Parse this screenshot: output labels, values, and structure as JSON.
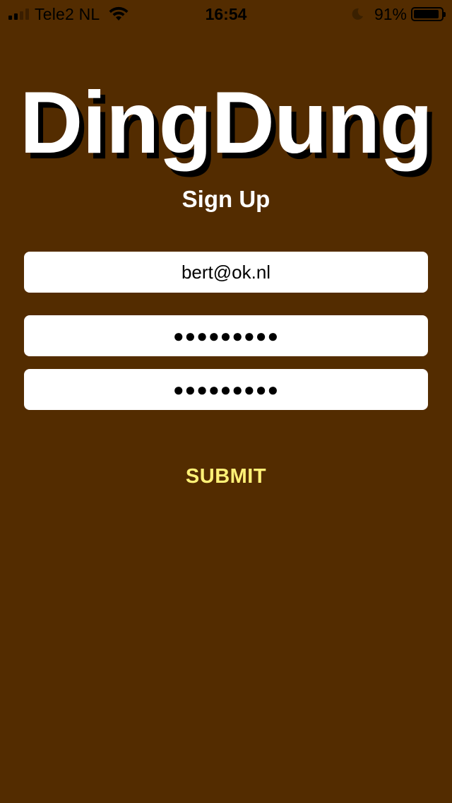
{
  "status_bar": {
    "carrier": "Tele2 NL",
    "time": "16:54",
    "battery_percent": "91%",
    "battery_level": 0.91
  },
  "app": {
    "title": "DingDung",
    "subtitle": "Sign Up"
  },
  "form": {
    "email_value": "bert@ok.nl",
    "password_masked": "●●●●●●●●●",
    "confirm_password_masked": "●●●●●●●●●",
    "submit_label": "SUBMIT"
  },
  "colors": {
    "background": "#532c00",
    "title": "#ffffff",
    "title_shadow": "#000000",
    "submit": "#fff176",
    "field_bg": "#ffffff"
  },
  "icons": [
    "cellular-signal-icon",
    "wifi-icon",
    "do-not-disturb-moon-icon",
    "battery-icon"
  ]
}
